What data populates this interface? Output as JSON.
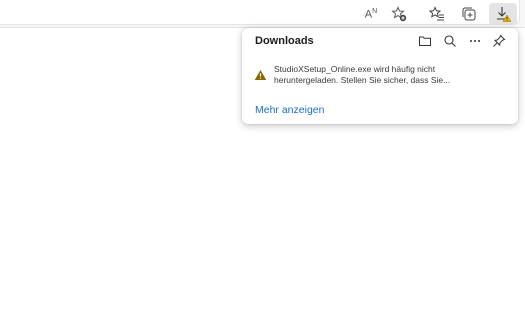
{
  "toolbar": {
    "read_aloud_label": "A",
    "read_aloud_sup": "N"
  },
  "downloads_panel": {
    "title": "Downloads",
    "item": {
      "line1": "StudioXSetup_Online.exe wird häufig nicht",
      "line2": "heruntergeladen. Stellen Sie sicher, dass Sie...",
      "status_icon": "warning-icon"
    },
    "more_link": "Mehr anzeigen",
    "header_icons": [
      "folder-icon",
      "search-icon",
      "more-icon",
      "pin-icon"
    ]
  },
  "colors": {
    "link": "#1a6fd1",
    "warning": "#f4b400",
    "warning_dark": "#8a6a00"
  }
}
